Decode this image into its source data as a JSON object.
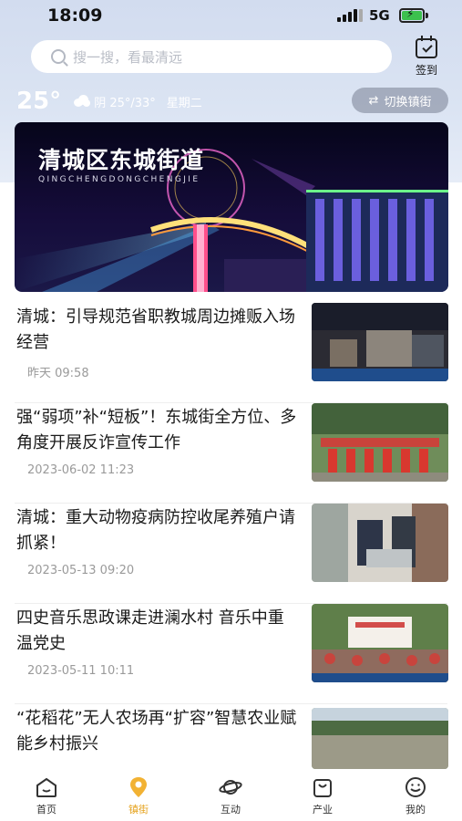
{
  "status_bar": {
    "time": "18:09",
    "network": "5G"
  },
  "search": {
    "placeholder": "搜一搜，看最清远"
  },
  "checkin": {
    "label": "签到"
  },
  "weather": {
    "temperature": "25°",
    "condition": "阴 25°/33°",
    "weekday": "星期二"
  },
  "switch_town": {
    "label": "切换镇街"
  },
  "banner": {
    "title": "清城区东城街道",
    "subtitle": "QINGCHENGDONGCHENGJIE"
  },
  "news": [
    {
      "title": "清城：引导规范省职教城周边摊贩入场经营",
      "time": "昨天 09:58"
    },
    {
      "title": "强“弱项”补“短板”！东城街全方位、多角度开展反诈宣传工作",
      "time": "2023-06-02 11:23"
    },
    {
      "title": "清城：重大动物疫病防控收尾养殖户请抓紧！",
      "time": "2023-05-13 09:20"
    },
    {
      "title": "四史音乐思政课走进澜水村 音乐中重温党史",
      "time": "2023-05-11 10:11"
    },
    {
      "title": "“花稻花”无人农场再“扩容”智慧农业赋能乡村振兴",
      "time": ""
    }
  ],
  "tabs": [
    {
      "label": "首页",
      "icon": "home-icon"
    },
    {
      "label": "镇街",
      "icon": "location-pin-icon",
      "active": true
    },
    {
      "label": "互动",
      "icon": "planet-icon"
    },
    {
      "label": "产业",
      "icon": "shopping-bag-icon"
    },
    {
      "label": "我的",
      "icon": "smiley-icon"
    }
  ],
  "colors": {
    "accent": "#e5a21c",
    "header_bg": "#d6dff0"
  }
}
